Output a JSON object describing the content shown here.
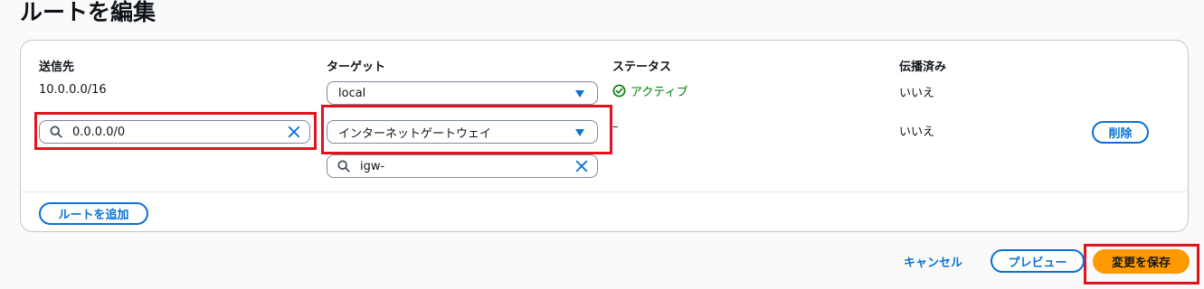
{
  "page": {
    "title": "ルートを編集"
  },
  "columns": {
    "destination": "送信先",
    "target": "ターゲット",
    "status": "ステータス",
    "propagated": "伝播済み"
  },
  "rows": [
    {
      "destination": "10.0.0.0/16",
      "target": "local",
      "status": "アクティブ",
      "propagated": "いいえ"
    },
    {
      "destination_input": "0.0.0.0/0",
      "target": "インターネットゲートウェイ",
      "target_filter": "igw-",
      "status": "–",
      "propagated": "いいえ",
      "remove_label": "削除"
    }
  ],
  "actions": {
    "add_route": "ルートを追加",
    "cancel": "キャンセル",
    "preview": "プレビュー",
    "save": "変更を保存"
  },
  "icons": {
    "status": "check-circle-icon",
    "search": "search-icon",
    "clear": "close-icon",
    "dropdown": "caret-down-icon"
  },
  "colors": {
    "link": "#0972d3",
    "success": "#037f0c",
    "primary": "#ff9900",
    "highlight": "#e0141e"
  }
}
